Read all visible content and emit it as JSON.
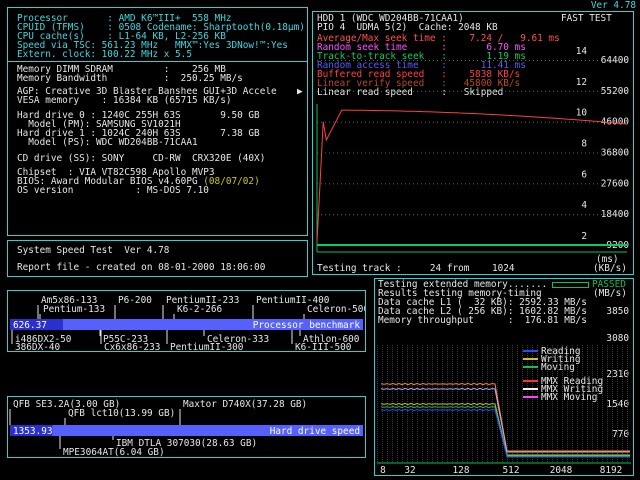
{
  "version": "Ver 4.78",
  "system": {
    "lines": [
      "Processor       : AMD K6™III+  558 MHz",
      "CPUID (TFMS)    : 0508 Codename: Sharptooth(0.18µm)",
      "CPU cache(s)    : L1-64 KB, L2-256 KB",
      "Speed via TSC: 561.23 MHz   MMX™:Yes 3DNow!™:Yes",
      "Extern. clock: 100.22 MHz x 5.5"
    ],
    "memory": [
      "Memory DIMM SDRAM         :    256 MB",
      "Memory Bandwidth          :  250.25 MB/s"
    ],
    "agp": "AGP: Creative 3D Blaster Banshee GUI+3D Accele",
    "agp_arrow": "▶",
    "vesa": "VESA memory    : 16384 KB (65715 KB/s)",
    "drives": [
      "Hard drive 0 : 1240C 255H 63S       9.50 GB",
      "  Model (PM): SAMSUNG SV1021H",
      "Hard drive 1 : 1024C 240H 63S       7.38 GB",
      "  Model (PS): WDC WD204BB-71CAA1"
    ],
    "cd": "CD drive (SS): SONY     CD-RW  CRX320E (40X)",
    "chipset": "Chipset  : VIA VT82C598 Apollo MVP3",
    "bios_prefix": "BIOS: Award Modular BIOS v4.60PG ",
    "bios_date": "(08/07/02)",
    "os": "OS version           : MS-DOS 7.10",
    "colors": {
      "bios_date": "#c8c810"
    }
  },
  "speedtest": {
    "title": "System Speed Test  Ver 4.78",
    "report": "Report file - created on 08-01-2000 18:06:00"
  },
  "hdd_test": {
    "header_left": "HDD 1 (WDC WD204BB-71CAA1)",
    "header_right": "FAST TEST",
    "pio": "PIO 4  UDMA 5(2)  Cache: 2048 KB",
    "rows": [
      {
        "label": "Average/Max seek time",
        "value": ":    7.24 /   9.61 ms",
        "color": "#ff5050"
      },
      {
        "label": "Random seek time",
        "value": ":       6.70 ms",
        "color": "#ff50ff"
      },
      {
        "label": "Track-to-track seek",
        "value": ":       1.19 ms",
        "color": "#00d060"
      },
      {
        "label": "Random access time",
        "value": ":      11.41 ms",
        "color": "#5a5aff"
      },
      {
        "label": "Buffered read speed",
        "value": ":    5838 KB/s",
        "color": "#ff4040"
      },
      {
        "label": "Linear verify speed",
        "value": ":   45800 KB/s",
        "color": "#b84a20"
      },
      {
        "label": "Linear read speed",
        "value": ":   Skipped",
        "color": "#e6e6e6"
      }
    ],
    "left_ticks": [
      "14",
      "12",
      "10",
      "8",
      "6",
      "4",
      "2"
    ],
    "right_ticks": [
      "64400",
      "55200",
      "46000",
      "36800",
      "27600",
      "18400",
      "9200"
    ],
    "footer": "Testing track :     24 from    1024",
    "unit_top": "(ms)",
    "unit_bottom": "(KB/s)"
  },
  "mem_test": {
    "line1": "Testing extended memory.......",
    "passed": "PASSED",
    "line2": "Results testing memory-timing",
    "unit": "(MB/s)",
    "rows": [
      "Data cache L1 (  32 KB): 2592.33 MB/s",
      "Data cache L2 ( 256 KB): 1602.82 MB/s",
      "Memory throughput      :  176.81 MB/s"
    ],
    "y_ticks": [
      "3850",
      "3080",
      "2310",
      "1540",
      "770"
    ],
    "x_ticks": [
      "8",
      "32",
      "128",
      "512",
      "2048",
      "8192"
    ],
    "legend": [
      {
        "name": "Reading",
        "color": "#2a4aff"
      },
      {
        "name": "Writing",
        "color": "#d0c020"
      },
      {
        "name": "Moving",
        "color": "#10c050"
      },
      {
        "name": "MMX Reading",
        "color": "#ff3030"
      },
      {
        "name": "MMX Writing",
        "color": "#f0f0f0"
      },
      {
        "name": "MMX Moving",
        "color": "#ff40ff"
      }
    ]
  },
  "cpu_bench": {
    "value": "626.37",
    "label": "Processor benchmark",
    "bar_fraction": 0.15,
    "top_labels": [
      "Am5x86-133",
      "P6-200",
      "PentiumII-233",
      "PentiumII-400",
      "Pentium-133",
      "K6-2-266",
      "Celeron-500"
    ],
    "bottom_labels": [
      "i486DX2-50",
      "P55C-233",
      "Celeron-333",
      "Athlon-600",
      "386DX-40",
      "Cx6x86-233",
      "PentiumII-300",
      "K6-III-500"
    ]
  },
  "hdd_bench": {
    "value": "1353.93",
    "label": "Hard drive speed",
    "bar_fraction": 0.12,
    "top_labels": [
      "QFB SE3.2A(3.00 GB)",
      "Maxtor D740X(37.28 GB)",
      "QFB lct10(13.99 GB)"
    ],
    "bottom_labels": [
      "IBM DTLA 307030(28.63 GB)",
      "MPE3064AT(6.04 GB)"
    ]
  }
}
